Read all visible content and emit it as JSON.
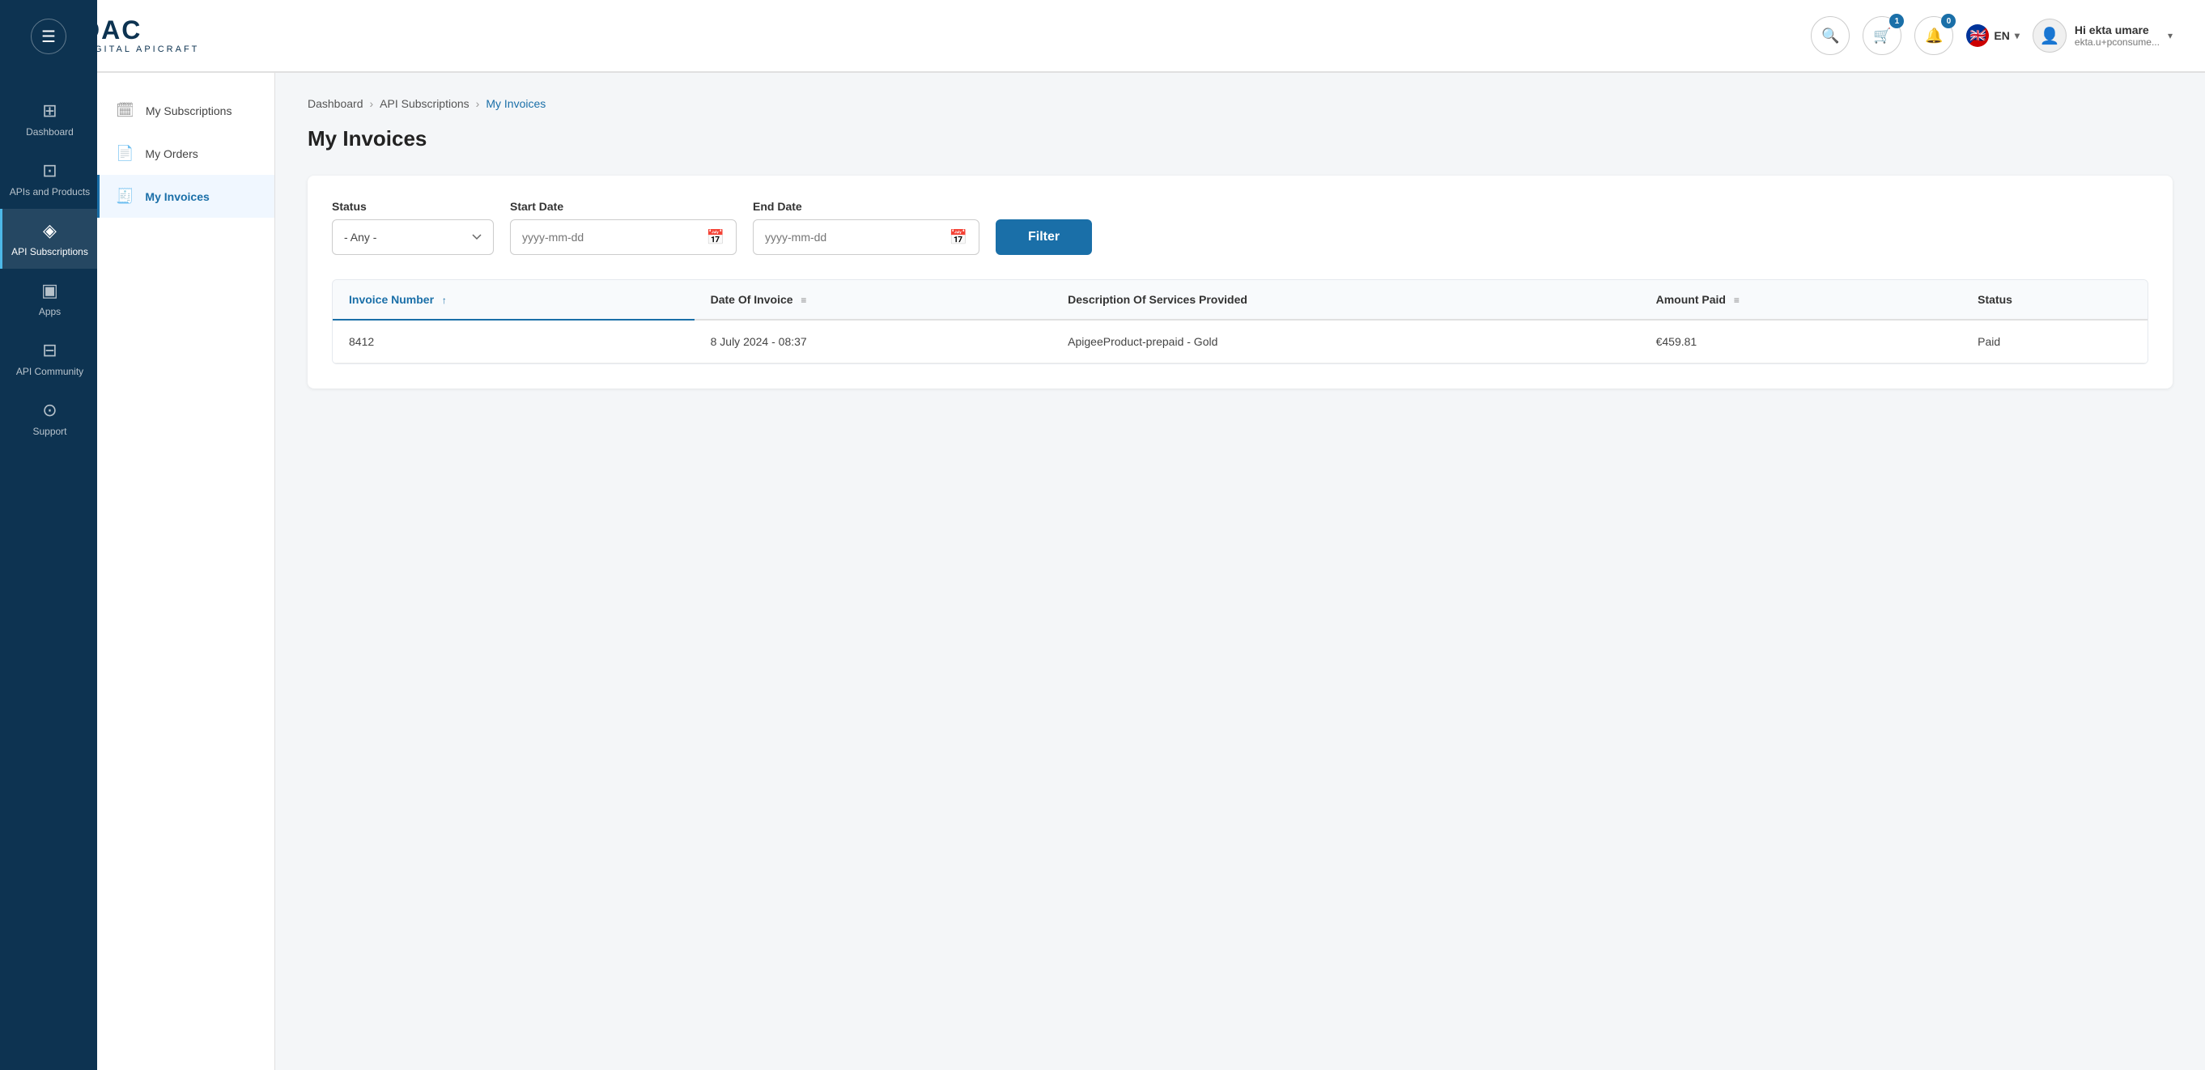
{
  "header": {
    "logo_main": "DAC",
    "logo_sub": "DIGITAL APICRAFT",
    "search_placeholder": "Search",
    "cart_badge": "1",
    "notifications_badge": "0",
    "lang": "EN",
    "user_greeting": "Hi ekta umare",
    "user_email": "ekta.u+pconsume..."
  },
  "sidebar": {
    "toggle_icon": "☰",
    "items": [
      {
        "id": "dashboard",
        "label": "Dashboard",
        "icon": "⊞"
      },
      {
        "id": "apis",
        "label": "APIs and Products",
        "icon": "⊡"
      },
      {
        "id": "api-subscriptions",
        "label": "API Subscriptions",
        "icon": "◈",
        "active": true
      },
      {
        "id": "apps",
        "label": "Apps",
        "icon": "▣"
      },
      {
        "id": "api-community",
        "label": "API Community",
        "icon": "⊟"
      },
      {
        "id": "support",
        "label": "Support",
        "icon": "⊙"
      }
    ]
  },
  "sub_sidebar": {
    "items": [
      {
        "id": "my-subscriptions",
        "label": "My Subscriptions",
        "icon": "🗓",
        "active": false
      },
      {
        "id": "my-orders",
        "label": "My Orders",
        "icon": "📄",
        "active": false
      },
      {
        "id": "my-invoices",
        "label": "My Invoices",
        "icon": "🧾",
        "active": true
      }
    ]
  },
  "breadcrumb": {
    "items": [
      {
        "label": "Dashboard",
        "active": false
      },
      {
        "label": "API Subscriptions",
        "active": false
      },
      {
        "label": "My Invoices",
        "active": true
      }
    ]
  },
  "page_title": "My Invoices",
  "filter": {
    "status_label": "Status",
    "status_default": "- Any -",
    "start_date_label": "Start Date",
    "start_date_placeholder": "yyyy-mm-dd",
    "end_date_label": "End Date",
    "end_date_placeholder": "yyyy-mm-dd",
    "filter_button_label": "Filter"
  },
  "table": {
    "columns": [
      {
        "id": "invoice-number",
        "label": "Invoice Number",
        "sorted": true,
        "filterable": false
      },
      {
        "id": "date-of-invoice",
        "label": "Date Of Invoice",
        "sorted": false,
        "filterable": true
      },
      {
        "id": "description",
        "label": "Description Of Services Provided",
        "sorted": false,
        "filterable": false
      },
      {
        "id": "amount-paid",
        "label": "Amount Paid",
        "sorted": false,
        "filterable": true
      },
      {
        "id": "status",
        "label": "Status",
        "sorted": false,
        "filterable": false
      }
    ],
    "rows": [
      {
        "invoice_number": "8412",
        "date_of_invoice": "8 July 2024 - 08:37",
        "description": "ApigeeProduct-prepaid - Gold",
        "amount_paid": "€459.81",
        "status": "Paid"
      }
    ]
  }
}
